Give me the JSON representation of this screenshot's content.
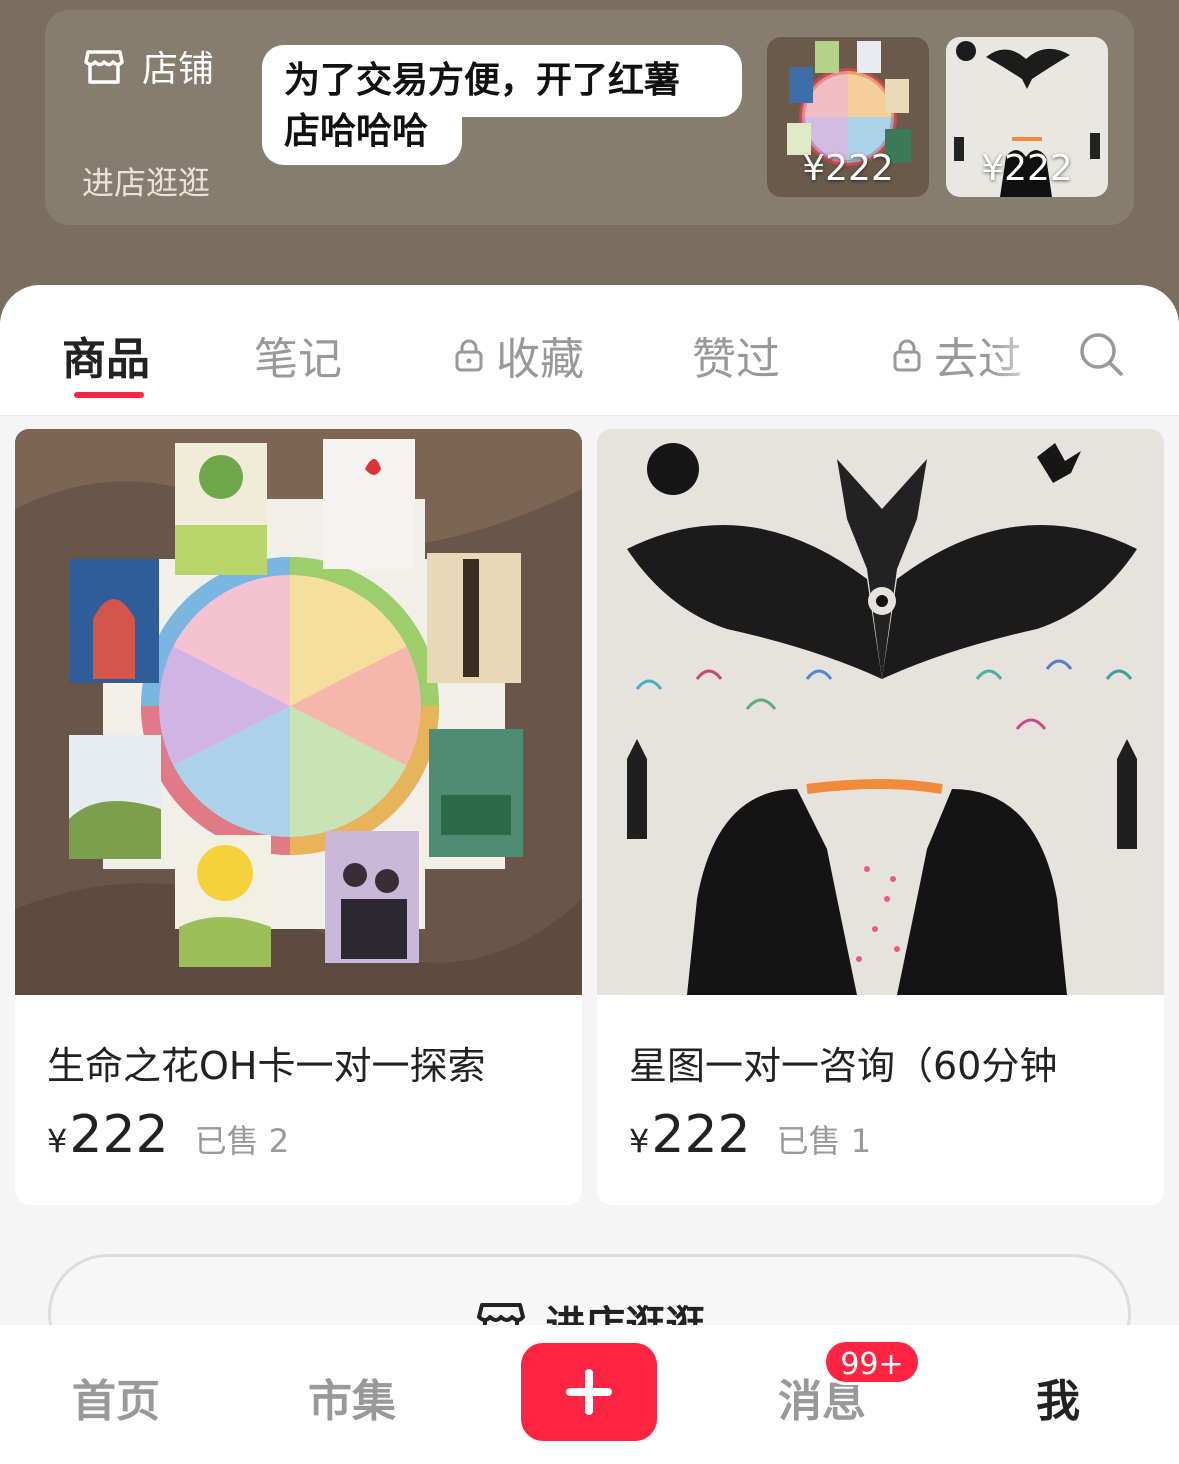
{
  "store": {
    "label": "店铺",
    "enter_link": "进店逛逛",
    "announcement_line1": "为了交易方便，开了红薯",
    "announcement_line2": "店哈哈哈",
    "thumbnails": [
      {
        "price": "¥222",
        "icon": "tarot-wheel-thumbnail"
      },
      {
        "price": "¥222",
        "icon": "raven-painting-thumbnail"
      }
    ]
  },
  "tabs": [
    {
      "label": "商品",
      "active": true
    },
    {
      "label": "笔记",
      "active": false
    },
    {
      "label": "收藏",
      "locked": true
    },
    {
      "label": "赞过",
      "active": false
    },
    {
      "label": "去过",
      "locked": true
    }
  ],
  "products": [
    {
      "title": "生命之花OH卡一对一探索",
      "currency": "¥",
      "price": "222",
      "sold": "已售 2"
    },
    {
      "title": "星图一对一咨询（60分钟",
      "currency": "¥",
      "price": "222",
      "sold": "已售 1"
    }
  ],
  "enter_store_button": "进店逛逛",
  "bottom_nav": {
    "home": "首页",
    "market": "市集",
    "messages": "消息",
    "messages_badge": "99+",
    "me": "我"
  },
  "colors": {
    "accent": "#ff2442",
    "banner_bg": "#7a6f5e"
  }
}
